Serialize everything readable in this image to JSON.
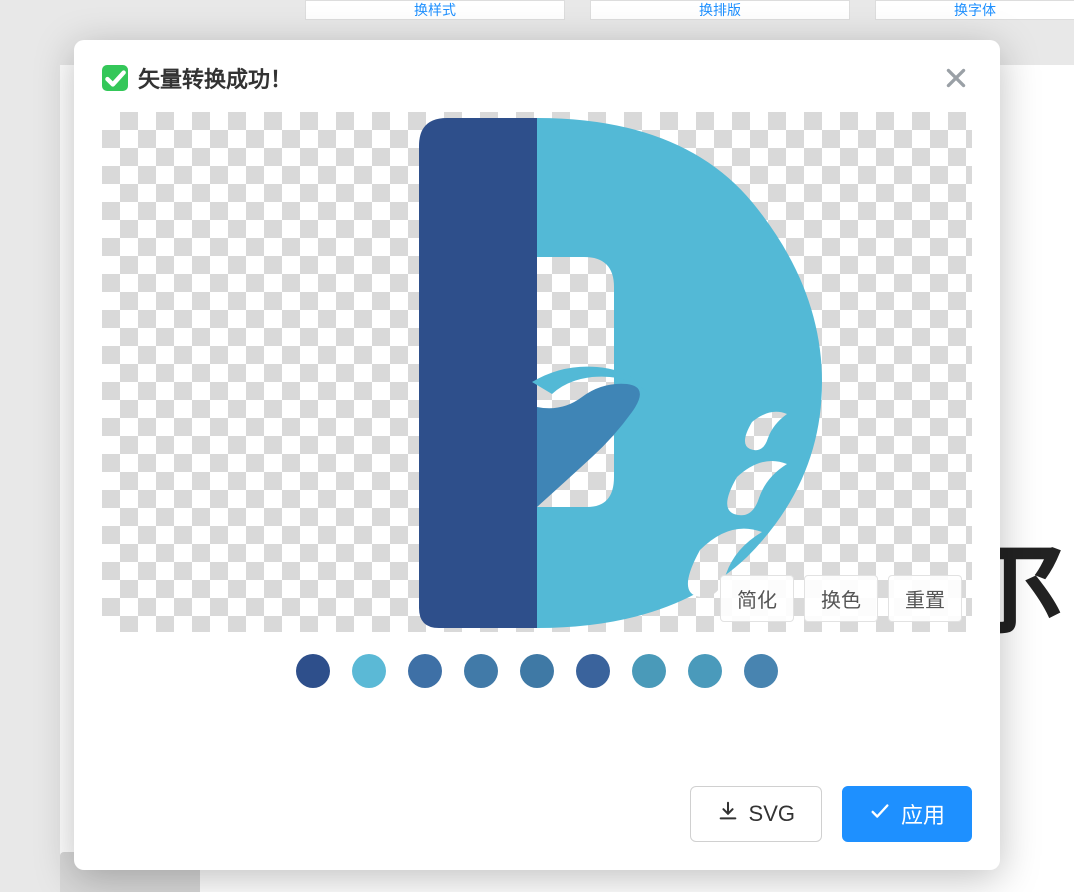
{
  "background": {
    "tab1": "换样式",
    "tab2": "换排版",
    "tab3": "换字体",
    "glyph": "尔"
  },
  "modal": {
    "title": "矢量转换成功！",
    "overlay": {
      "simplify": "简化",
      "recolor": "换色",
      "reset": "重置"
    },
    "footer": {
      "svg_label": "SVG",
      "apply_label": "应用"
    }
  },
  "palette": [
    "#2e4f8b",
    "#5bb9d6",
    "#3e70a6",
    "#417aa8",
    "#3f79a5",
    "#3a639c",
    "#4a9ab9",
    "#4a9abb",
    "#4884b0"
  ],
  "logo": {
    "dark": "#2e4f8b",
    "light": "#53b9d6"
  }
}
